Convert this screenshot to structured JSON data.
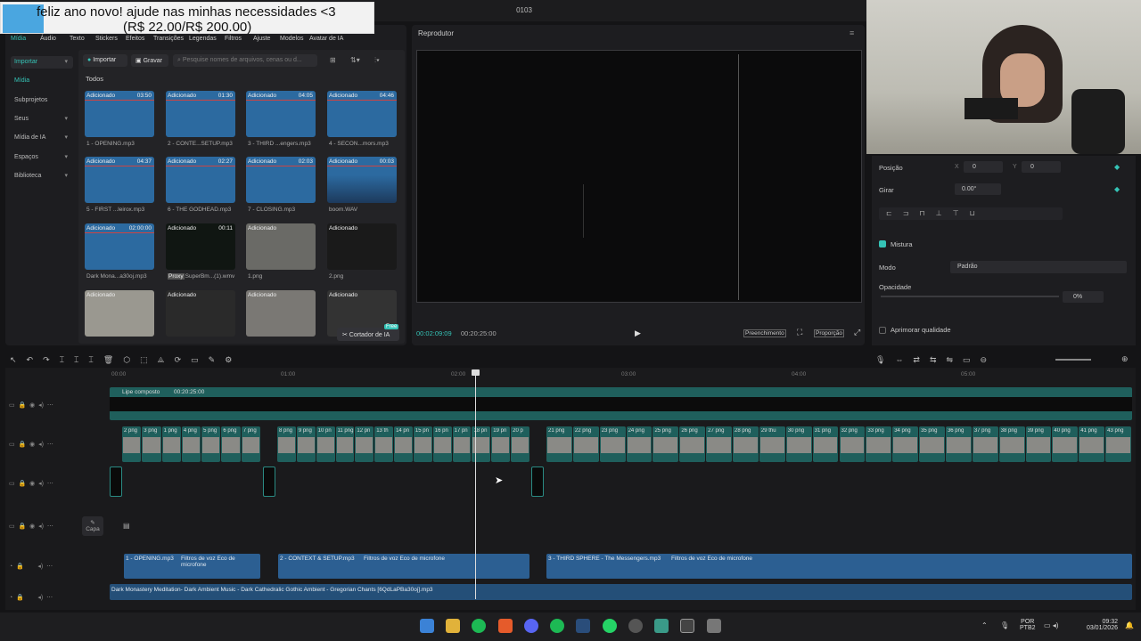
{
  "window": {
    "title": "0103"
  },
  "donation": {
    "line1": "feliz ano novo! ajude nas minhas necessidades <3",
    "line2": "(R$ 22.00/R$ 200.00)"
  },
  "tabs": [
    "Mídia",
    "Áudio",
    "Texto",
    "Stickers",
    "Efeitos",
    "Transições",
    "Legendas",
    "Filtros",
    "Ajuste",
    "Modelos",
    "Avatar de IA"
  ],
  "sidebar": [
    {
      "label": "Importar"
    },
    {
      "label": "Mídia"
    },
    {
      "label": "Subprojetos"
    },
    {
      "label": "Seus"
    },
    {
      "label": "Mídia de IA"
    },
    {
      "label": "Espaços"
    },
    {
      "label": "Biblioteca"
    }
  ],
  "media": {
    "import_label": "Importar",
    "record_label": "Gravar",
    "search_placeholder": "Pesquise nomes de arquivos, cenas ou d...",
    "section": "Todos",
    "items": [
      {
        "tag": "Adicionado",
        "dur": "03:50",
        "name": "1 - OPENING.mp3"
      },
      {
        "tag": "Adicionado",
        "dur": "01:30",
        "name": "2 - CONTE...SETUP.mp3"
      },
      {
        "tag": "Adicionado",
        "dur": "04:05",
        "name": "3 - THIRD ...engers.mp3"
      },
      {
        "tag": "Adicionado",
        "dur": "04:46",
        "name": "4 - SECON...mors.mp3"
      },
      {
        "tag": "Adicionado",
        "dur": "04:37",
        "name": "5 - FIRST ...leirox.mp3"
      },
      {
        "tag": "Adicionado",
        "dur": "02:27",
        "name": "6 - THE GODHEAD.mp3"
      },
      {
        "tag": "Adicionado",
        "dur": "02:03",
        "name": "7 - CLOSING.mp3"
      },
      {
        "tag": "Adicionado",
        "dur": "00:03",
        "name": "boom.WAV"
      },
      {
        "tag": "Adicionado",
        "dur": "02:00:00",
        "name": "Dark Mona...a30oj.mp3"
      },
      {
        "tag": "Adicionado",
        "dur": "00:11",
        "name": "SuperBm...(1).wmv"
      },
      {
        "tag": "Adicionado",
        "dur": "",
        "name": "1.png"
      },
      {
        "tag": "Adicionado",
        "dur": "",
        "name": "2.png"
      },
      {
        "tag": "Adicionado",
        "dur": "",
        "name": ""
      },
      {
        "tag": "Adicionado",
        "dur": "",
        "name": ""
      },
      {
        "tag": "Adicionado",
        "dur": "",
        "name": ""
      },
      {
        "tag": "Adicionado",
        "dur": "",
        "name": ""
      }
    ],
    "proxy_badge": "Proxy",
    "cutter_label": "Cortador de IA",
    "free_badge": "Free"
  },
  "player": {
    "title": "Reprodutor",
    "current_time": "00:02:09:09",
    "total_time": "00:20:25:00",
    "fill_label": "Preenchimento",
    "ratio_label": "Proporção"
  },
  "props": {
    "position_label": "Posição",
    "x_label": "X",
    "x_value": "0",
    "y_label": "Y",
    "y_value": "0",
    "rotate_label": "Girar",
    "rotate_value": "0.00°",
    "mix_label": "Mistura",
    "mode_label": "Modo",
    "mode_value": "Padrão",
    "opacity_label": "Opacidade",
    "opacity_value": "0%",
    "enhance_label": "Aprimorar qualidade"
  },
  "timeline": {
    "ruler": [
      "00:00",
      "01:00",
      "02:00",
      "03:00",
      "04:00",
      "05:00"
    ],
    "composite_label": "Lipe composto",
    "composite_time": "00:20:25:00",
    "images": [
      "2 png",
      "3 png",
      "1 png",
      "4 png",
      "5 png",
      "6 png",
      "7 png",
      "8 png",
      "9 png",
      "10 pn",
      "11 png",
      "12 pn",
      "13 th",
      "14 pn",
      "15 pn",
      "16 pn",
      "17 pn",
      "18 pn",
      "19 pn",
      "20 p",
      "21 png",
      "22 png",
      "23 png",
      "24 png",
      "25 png",
      "26 png",
      "27 png",
      "28 png",
      "29 thu",
      "30 png",
      "31 png",
      "32 png",
      "33 png",
      "34 png",
      "35 png",
      "36 png",
      "37 png",
      "38 png",
      "39 png",
      "40 png",
      "41 png",
      "43 png"
    ],
    "cover_label": "Capa",
    "audio_clips": [
      {
        "name": "1 - OPENING.mp3",
        "fx": "Filtros de voz Eco de microfone"
      },
      {
        "name": "2 - CONTEXT & SETUP.mp3",
        "fx": "Filtros de voz Eco de microfone"
      },
      {
        "name": "3 - THIRD SPHERE - The Messengers.mp3",
        "fx": "Filtros de voz Eco de microfone"
      }
    ],
    "music_track": "Dark Monastery Meditation- Dark Ambient Music - Dark Cathedralic Gothic Ambient - Gregorian Chants [6QdLaPBa30oj].mp3"
  },
  "taskbar": {
    "lang": "POR",
    "layout": "PTB2",
    "time": "09:32",
    "date": "03/01/2026"
  }
}
